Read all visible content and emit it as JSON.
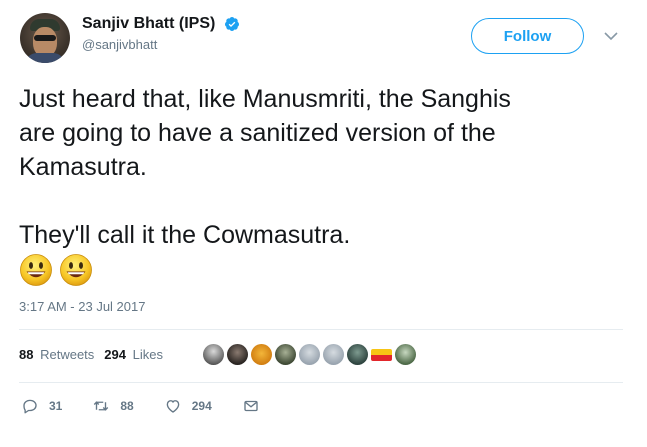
{
  "user": {
    "display_name": "Sanjiv Bhatt (IPS)",
    "handle": "@sanjivbhatt",
    "verified": true
  },
  "follow_label": "Follow",
  "tweet": {
    "text": "Just heard that, like Manusmriti, the Sanghis\nare going to have a sanitized version of the\nKamasutra.\n\nThey'll call it the Cowmasutra.",
    "emoji": [
      "grinning-face",
      "grinning-face"
    ],
    "timestamp": "3:17 AM - 23 Jul 2017"
  },
  "stats": {
    "retweets_count": "88",
    "retweets_label": "Retweets",
    "likes_count": "294",
    "likes_label": "Likes"
  },
  "actions": {
    "reply_count": "31",
    "retweet_count": "88",
    "like_count": "294"
  },
  "colors": {
    "accent": "#1da1f2",
    "secondary_text": "#657786",
    "primary_text": "#14171a",
    "divider": "#e6ecf0"
  }
}
